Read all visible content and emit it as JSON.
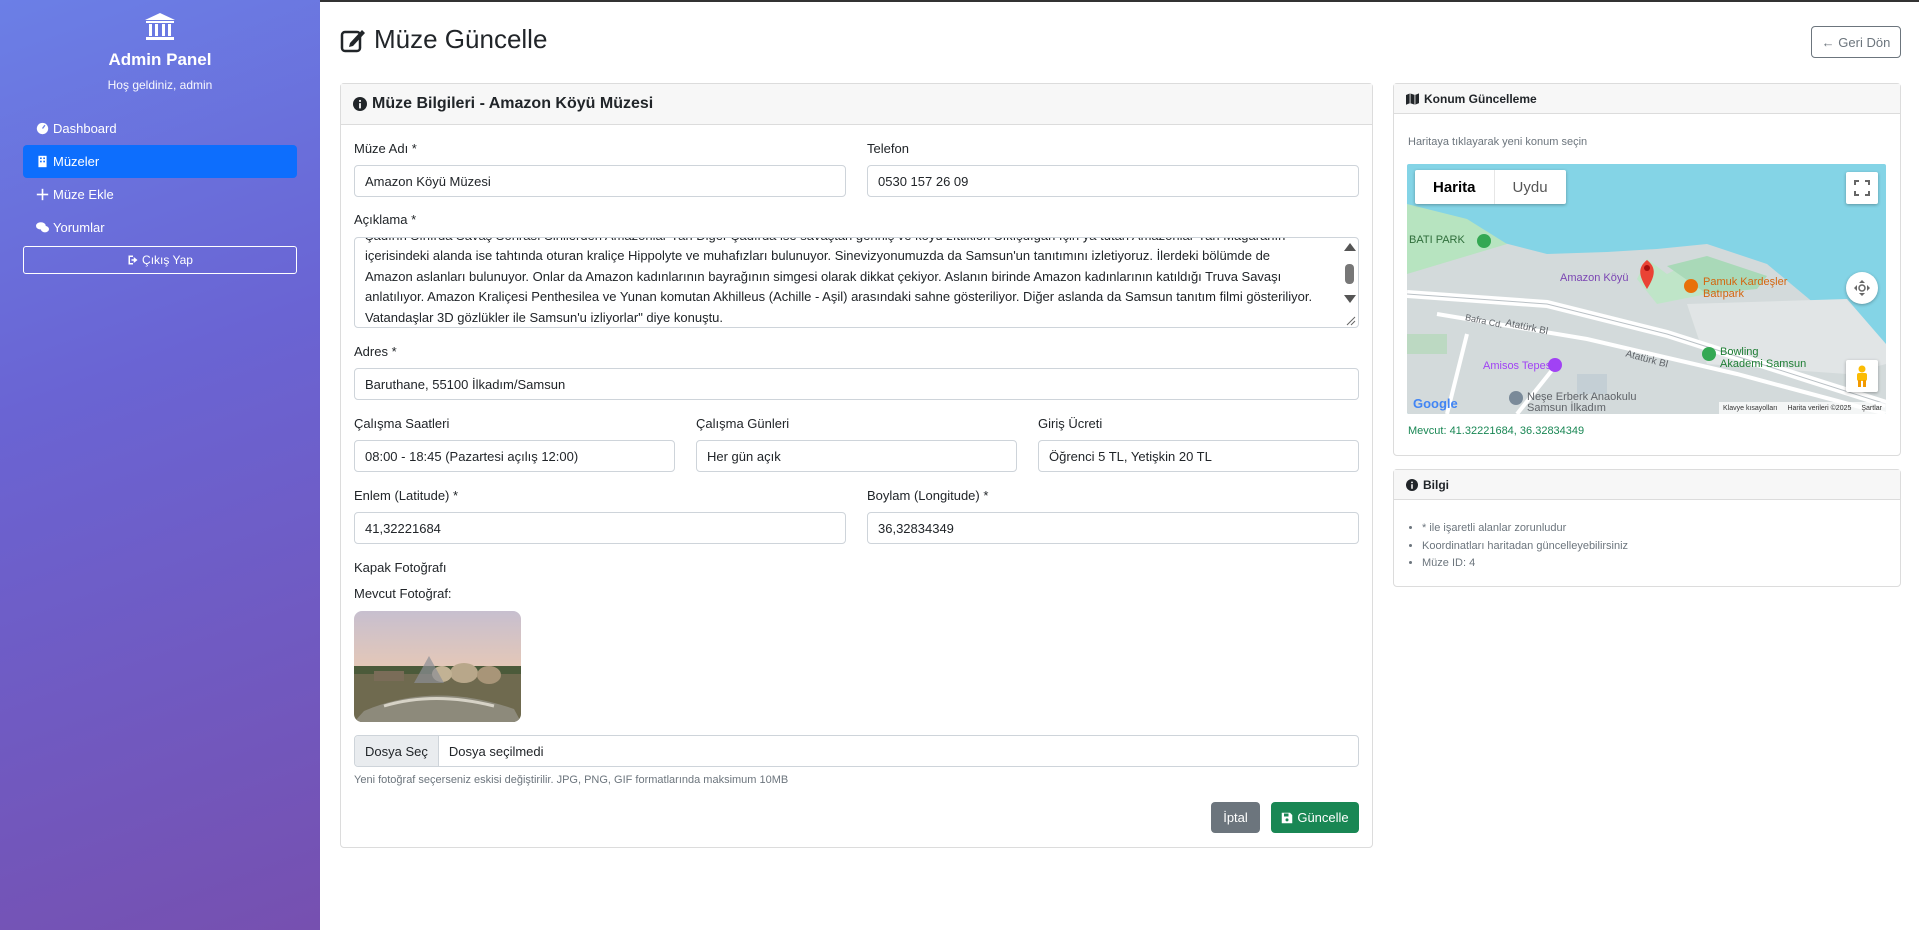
{
  "sidebar": {
    "title": "Admin Panel",
    "welcome": "Hoş geldiniz, admin",
    "items": [
      {
        "label": "Dashboard",
        "icon": "dashboard-icon",
        "active": false
      },
      {
        "label": "Müzeler",
        "icon": "building-icon",
        "active": true
      },
      {
        "label": "Müze Ekle",
        "icon": "plus-icon",
        "active": false
      },
      {
        "label": "Yorumlar",
        "icon": "comments-icon",
        "active": false
      }
    ],
    "logout_label": "Çıkış Yap"
  },
  "header": {
    "title": "Müze Güncelle",
    "back_label": "← Geri Dön"
  },
  "form": {
    "card_title": "Müze Bilgileri - Amazon Köyü Müzesi",
    "name_label": "Müze Adı *",
    "name_value": "Amazon Köyü Müzesi",
    "phone_label": "Telefon",
    "phone_value": "0530 157 26 09",
    "desc_label": "Açıklama *",
    "desc_lines": [
      "Şadırın Sınırda Savaş Sonrası Sinilerden Amazonlar Yan Diğer Şadırda ise savaştan geriniş ve köyü zıttikleri Sıkışdığan İçin ya tutan Amazonlar Yan Mağaranın",
      "içerisindeki alanda ise tahtında oturan kraliçe Hippolyte ve muhafızları bulunuyor. Sinevizyonumuzda da Samsun'un tanıtımını izletiyoruz. İlerdeki bölümde de",
      "Amazon aslanları bulunuyor. Onlar da Amazon kadınlarının bayrağının simgesi olarak dikkat çekiyor. Aslanın birinde Amazon kadınlarının katıldığı Truva Savaşı",
      "anlatılıyor. Amazon Kraliçesi Penthesilea ve Yunan komutan Akhilleus (Achille - Aşil) arasındaki sahne gösteriliyor. Diğer aslanda da Samsun tanıtım filmi gösteriliyor.",
      "Vatandaşlar 3D gözlükler ile Samsun'u izliyorlar\" diye konuştu."
    ],
    "address_label": "Adres *",
    "address_value": "Baruthane, 55100 İlkadım/Samsun",
    "hours_label": "Çalışma Saatleri",
    "hours_value": "08:00 - 18:45 (Pazartesi açılış 12:00)",
    "days_label": "Çalışma Günleri",
    "days_value": "Her gün açık",
    "fee_label": "Giriş Ücreti",
    "fee_value": "Öğrenci 5 TL, Yetişkin 20 TL",
    "lat_label": "Enlem (Latitude) *",
    "lat_value": "41,32221684",
    "lng_label": "Boylam (Longitude) *",
    "lng_value": "36,32834349",
    "cover_label": "Kapak Fotoğrafı",
    "current_photo_label": "Mevcut Fotoğraf:",
    "file_button": "Dosya Seç",
    "file_text": "Dosya seçilmedi",
    "file_hint": "Yeni fotoğraf seçerseniz eskisi değiştirilir. JPG, PNG, GIF formatlarında maksimum 10MB",
    "cancel_label": "İptal",
    "save_label": "Güncelle"
  },
  "location": {
    "title": "Konum Güncelleme",
    "hint": "Haritaya tıklayarak yeni konum seçin",
    "map_tab_map": "Harita",
    "map_tab_sat": "Uydu",
    "map_labels": {
      "park": "BATI PARK",
      "village": "Amazon Köyü",
      "pamuk1": "Pamuk Kardeşler",
      "pamuk2": "Batıpark",
      "ataturk1": "Atatürk Bl",
      "ataturk2": "Atatürk Bl",
      "bafra": "Bafra Cd.",
      "amisos": "Amisos Tepesi",
      "bowling1": "Bowling",
      "bowling2": "Akademi Samsun",
      "nese1": "Neşe Erberk Anaokulu",
      "nese2": "Samsun İlkadım",
      "google": "Google",
      "shortcuts": "Klavye kısayolları",
      "mapdata": "Harita verileri ©2025",
      "terms": "Şartlar"
    },
    "current": "Mevcut: 41.32221684, 36.32834349"
  },
  "info": {
    "title": "Bilgi",
    "items": [
      "* ile işaretli alanlar zorunludur",
      "Koordinatları haritadan güncelleyebilirsiniz",
      "Müze ID: 4"
    ]
  },
  "colors": {
    "primary": "#0d6efd",
    "success": "#198754",
    "secondary": "#6c757d",
    "water": "#84d4e6"
  }
}
